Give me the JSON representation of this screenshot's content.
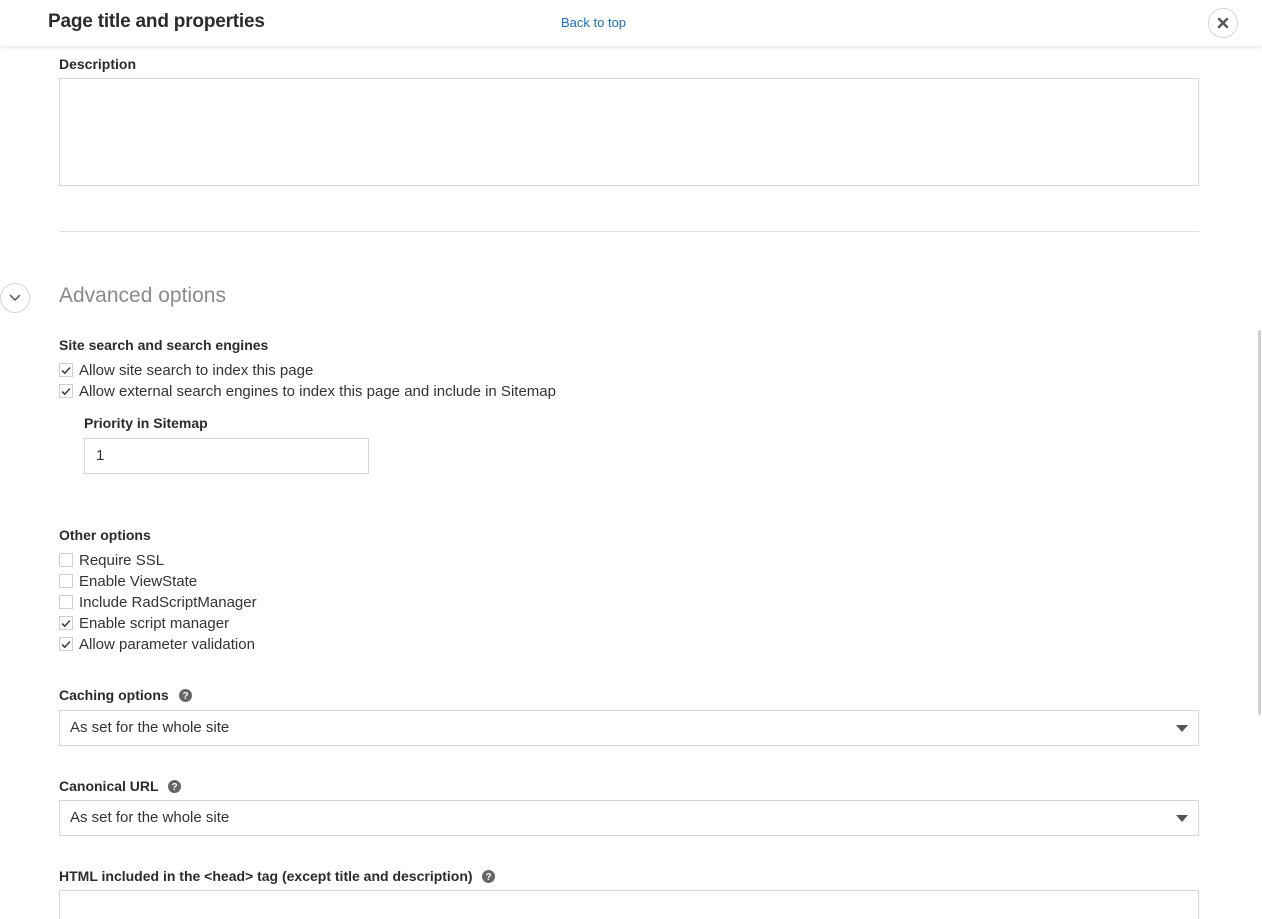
{
  "header": {
    "title": "Page title and properties",
    "back_to_top": "Back to top",
    "close_icon": "close-icon"
  },
  "description": {
    "label": "Description",
    "value": ""
  },
  "advanced": {
    "heading": "Advanced options",
    "toggle_icon": "chevron-down-icon"
  },
  "search": {
    "label": "Site search and search engines",
    "options": [
      {
        "label": "Allow site search to index this page",
        "checked": true
      },
      {
        "label": "Allow external search engines to index this page and include in Sitemap",
        "checked": true
      }
    ],
    "priority_label": "Priority in Sitemap",
    "priority_value": "1"
  },
  "other": {
    "label": "Other options",
    "options": [
      {
        "label": "Require SSL",
        "checked": false
      },
      {
        "label": "Enable ViewState",
        "checked": false
      },
      {
        "label": "Include RadScriptManager",
        "checked": false
      },
      {
        "label": "Enable script manager",
        "checked": true
      },
      {
        "label": "Allow parameter validation",
        "checked": true
      }
    ]
  },
  "caching": {
    "label": "Caching options",
    "value": "As set for the whole site"
  },
  "canonical": {
    "label": "Canonical URL",
    "value": "As set for the whole site"
  },
  "head_html": {
    "label": "HTML included in the <head> tag (except title and description)",
    "value": ""
  },
  "colors": {
    "link": "#1a6fb5",
    "muted_heading": "#8a8a8a",
    "border": "#d6d6d6"
  }
}
